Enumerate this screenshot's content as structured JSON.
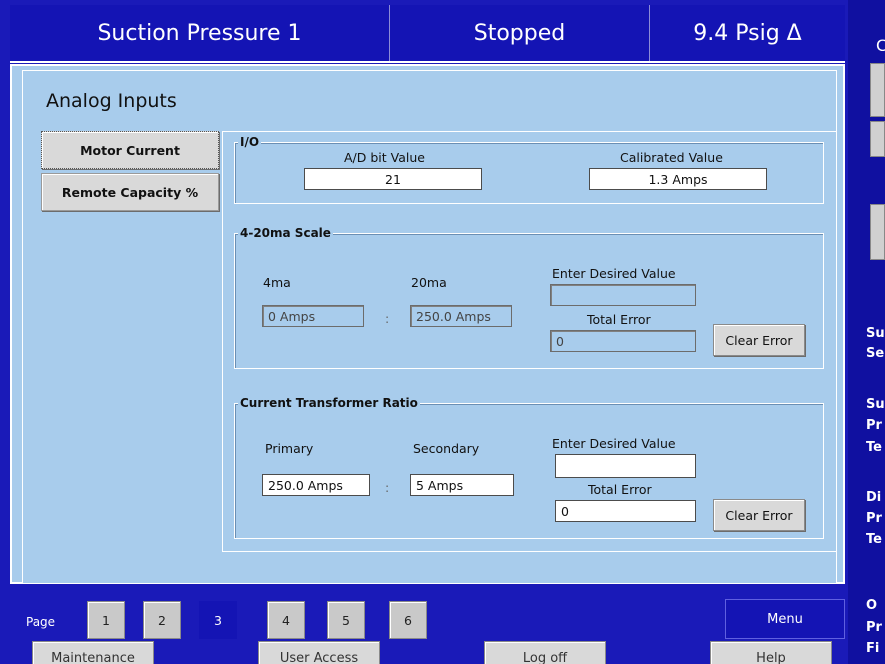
{
  "header": {
    "title": "Suction Pressure 1",
    "status": "Stopped",
    "value": "9.4 Psig Δ",
    "right_cut": "C"
  },
  "page_title": "Analog Inputs",
  "side_tabs": [
    "Motor Current",
    "Remote Capacity %"
  ],
  "io": {
    "legend": "I/O",
    "ad_label": "A/D bit Value",
    "ad_value": "21",
    "cal_label": "Calibrated Value",
    "cal_value": "1.3 Amps"
  },
  "scale": {
    "legend": "4-20ma Scale",
    "label_4ma": "4ma",
    "label_20ma": "20ma",
    "value_4ma": "0 Amps",
    "value_20ma": "250.0 Amps",
    "separator": ":",
    "desired_label": "Enter Desired Value",
    "desired_value": "",
    "error_label": "Total Error",
    "error_value": "0",
    "clear_label": "Clear Error"
  },
  "ct_ratio": {
    "legend": "Current Transformer Ratio",
    "primary_label": "Primary",
    "secondary_label": "Secondary",
    "primary_value": "250.0 Amps",
    "secondary_value": "5 Amps",
    "separator": ":",
    "desired_label": "Enter Desired Value",
    "desired_value": "",
    "error_label": "Total Error",
    "error_value": "0",
    "clear_label": "Clear Error"
  },
  "pager": {
    "label": "Page",
    "pages": [
      "1",
      "2",
      "3",
      "4",
      "5",
      "6"
    ],
    "active": "3",
    "menu": "Menu"
  },
  "footer": [
    "Maintenance",
    "User Access",
    "Log off",
    "Help"
  ],
  "right_strip": [
    "Su",
    "Se",
    "Su",
    "Pr",
    "Te",
    "Di",
    "Pr",
    "Te",
    "O",
    "Pr",
    "Fi"
  ],
  "colors": {
    "header_blue": "#1414b4",
    "panel": "#a8ccec",
    "button": "#d9d9d9"
  }
}
